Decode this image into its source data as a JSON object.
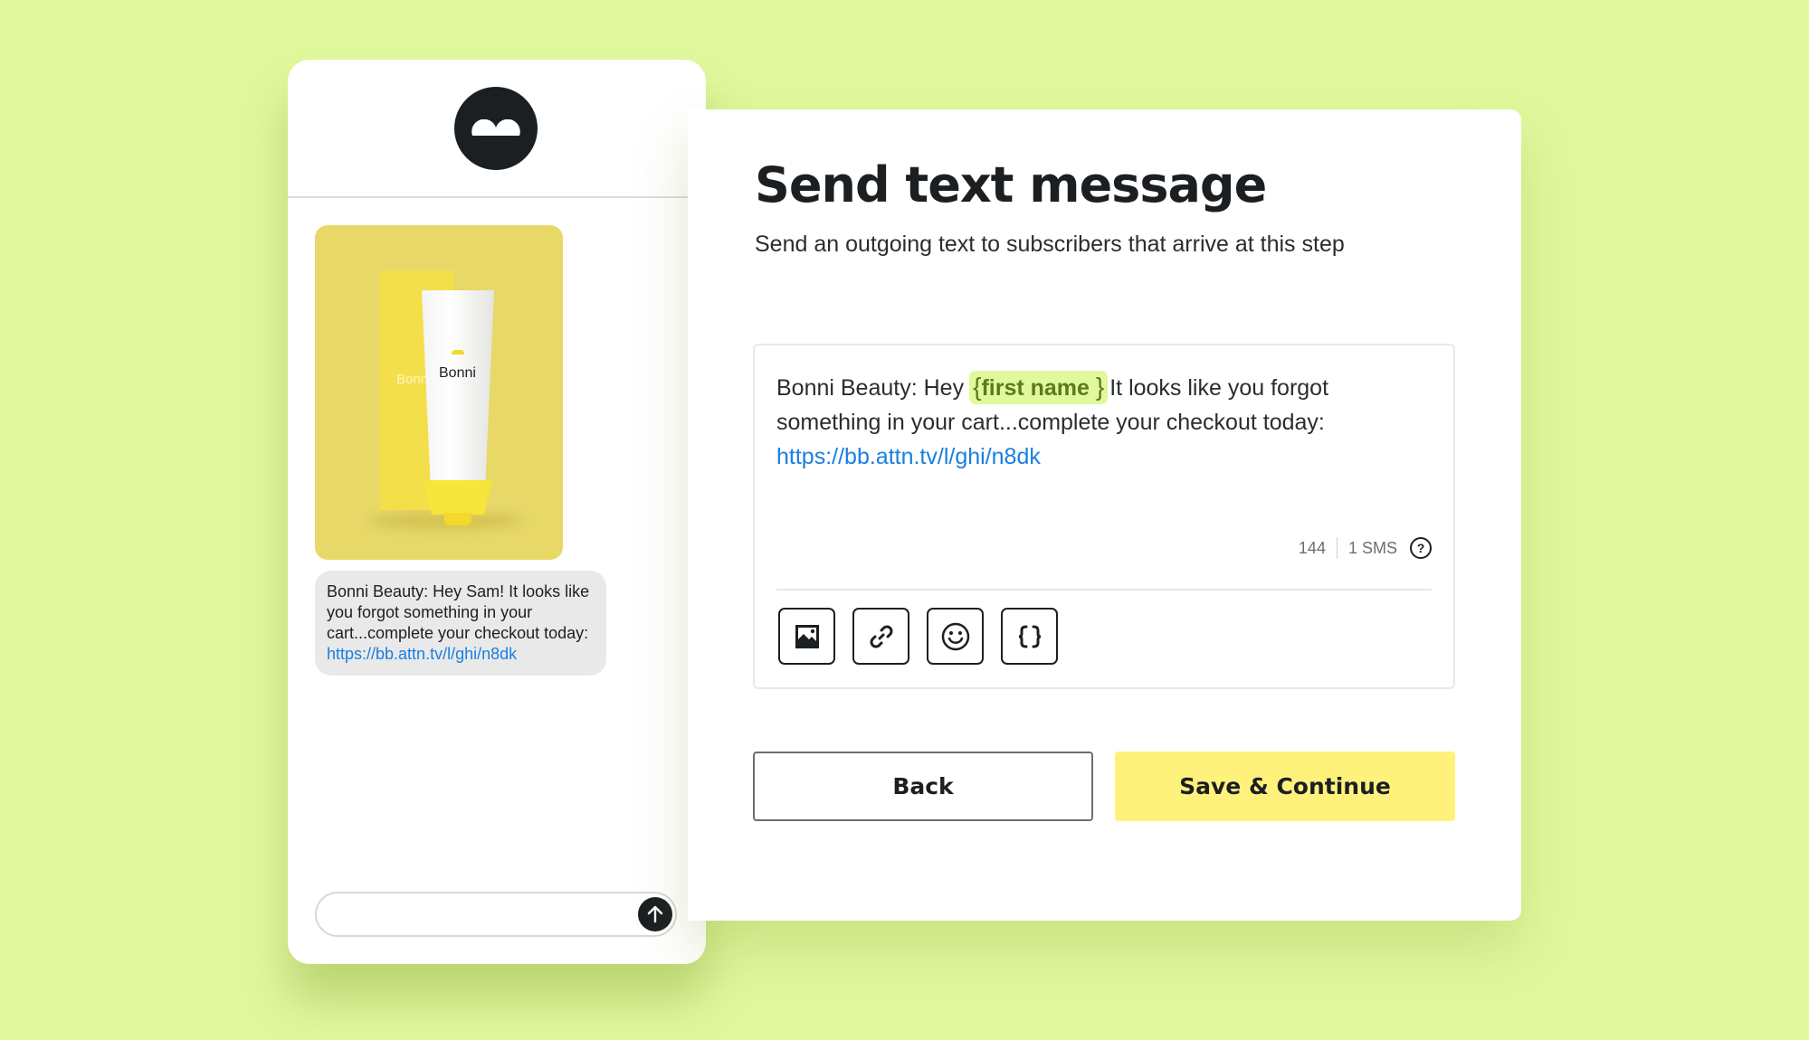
{
  "colors": {
    "background": "#e1f89d",
    "accent_yellow": "#fff27c",
    "token_bg": "#e1f89d",
    "token_text": "#5a7a1c",
    "link": "#1a7fe0",
    "dark": "#1c1f22"
  },
  "phone": {
    "avatar_icon": "brand-logo-icon",
    "product_image": {
      "brand_label": "Bonni",
      "alt": "Bonni product tube and box on yellow background"
    },
    "message_bubble": {
      "text": "Bonni Beauty: Hey Sam! It looks like you forgot something in your cart...complete your checkout today:",
      "link": "https://bb.attn.tv/l/ghi/n8dk"
    },
    "composer": {
      "value": "",
      "placeholder": "",
      "send_icon": "arrow-up-icon"
    }
  },
  "panel": {
    "title": "Send text message",
    "subtitle": "Send an outgoing text to subscribers that arrive at this step",
    "editor": {
      "text_before_token": "Bonni Beauty: Hey",
      "token_open": "{",
      "token_label": "first name",
      "token_close": "}",
      "text_after_token": "It looks like you forgot something in your cart...complete your checkout today:",
      "link": "https://bb.attn.tv/l/ghi/n8dk",
      "char_count": "144",
      "sms_count": "1 SMS",
      "help_icon": "question-circle-icon",
      "help_glyph": "?"
    },
    "toolbar": [
      {
        "name": "insert-image",
        "icon": "image-icon"
      },
      {
        "name": "insert-link",
        "icon": "link-icon"
      },
      {
        "name": "insert-emoji",
        "icon": "smiley-icon"
      },
      {
        "name": "insert-variable",
        "icon": "braces-icon"
      }
    ],
    "buttons": {
      "back": "Back",
      "save": "Save & Continue"
    }
  }
}
